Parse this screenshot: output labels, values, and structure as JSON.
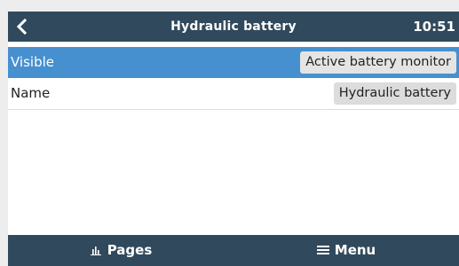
{
  "header": {
    "back_icon": "chevron-left-icon",
    "title": "Hydraulic battery",
    "time": "10:51"
  },
  "rows": [
    {
      "label": "Visible",
      "value": "Active battery monitor",
      "selected": true
    },
    {
      "label": "Name",
      "value": "Hydraulic battery",
      "selected": false
    }
  ],
  "footer": {
    "pages_icon": "bar-chart-icon",
    "pages_label": "Pages",
    "menu_icon": "hamburger-menu-icon",
    "menu_label": "Menu"
  },
  "colors": {
    "header_bg": "#30495c",
    "selected_row_bg": "#4790d0",
    "value_box_bg": "#dcdcdc"
  }
}
